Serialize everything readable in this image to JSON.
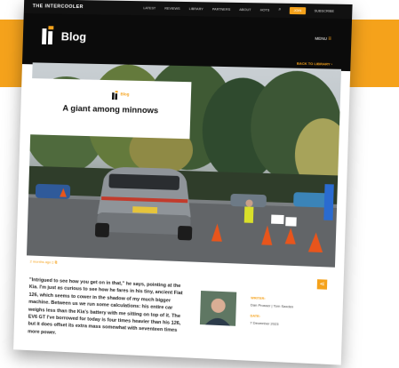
{
  "topnav": {
    "brand": "THE INTERCOOLER",
    "links": [
      "LATEST",
      "REVIEWS",
      "LIBRARY",
      "PARTNERS",
      "ABOUT",
      "HOTS"
    ],
    "search_label": "⌕",
    "join_label": "JOIN",
    "subscribe_label": "SUBSCRIBE"
  },
  "header": {
    "title": "Blog",
    "menu_label": "MENU",
    "back_label": "BACK TO LIBRARY ›"
  },
  "card": {
    "tag": "Blog",
    "title": "A giant among minnows"
  },
  "article": {
    "meta": "2 months ago",
    "paragraph": "\"Intrigued to see how you get on in that,\" he says, pointing at the Kia. I'm just as curious to see how he fares in his tiny, ancient Fiat 126, which seems to cower in the shadow of my much bigger machine. Between us we run some calculations: his entire car weighs less than the Kia's battery with me sitting on top of it. The EV6 GT I've borrowed for today is four times heavier than his 126, but it does offset its extra mass somewhat with seventeen times more power.",
    "writer_label": "WRITER:",
    "writer_value": "Dan Prosser | Tom Saxden",
    "date_label": "DATE:",
    "date_value": "7 December 2023"
  },
  "colors": {
    "accent": "#f5a21b",
    "header_bg": "#0b0b0b"
  },
  "icons": {
    "share": "share-icon",
    "menu": "hamburger-icon",
    "logo": "intercooler-logo-icon"
  }
}
